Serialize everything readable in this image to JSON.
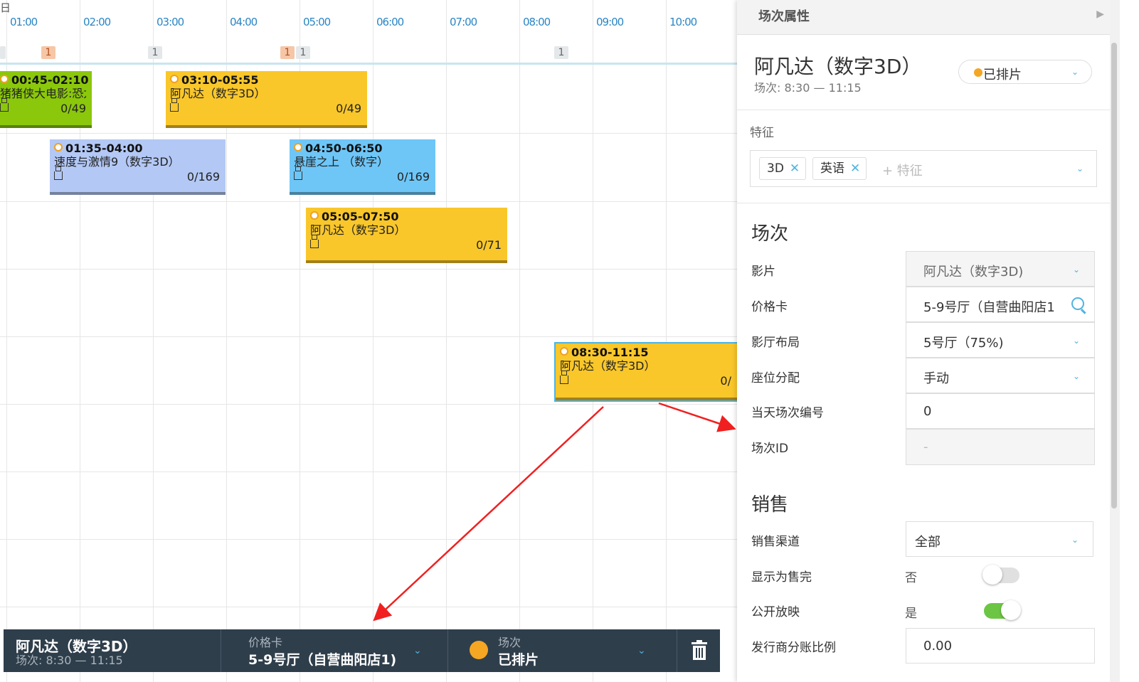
{
  "timeline": {
    "day_label": "日",
    "hours": [
      "01:00",
      "02:00",
      "03:00",
      "04:00",
      "05:00",
      "06:00",
      "07:00",
      "08:00",
      "09:00",
      "10:00"
    ],
    "counts": [
      {
        "value": "1",
        "style": "orange"
      },
      {
        "value": "1",
        "style": "grey"
      },
      {
        "value": "1",
        "style": "orange"
      },
      {
        "value": "1",
        "style": "grey"
      },
      {
        "value": "1",
        "style": "grey"
      }
    ],
    "sessions": [
      {
        "time": "00:45-02:10",
        "title": "猪猪侠大电影:恐龙",
        "occupancy": "0/49",
        "color": "green"
      },
      {
        "time": "03:10-05:55",
        "title": "阿凡达（数字3D）",
        "occupancy": "0/49",
        "color": "yellow"
      },
      {
        "time": "01:35-04:00",
        "title": "速度与激情9（数字3D）",
        "occupancy": "0/169",
        "color": "lightblue"
      },
      {
        "time": "04:50-06:50",
        "title": "悬崖之上 （数字）",
        "occupancy": "0/169",
        "color": "skyblue"
      },
      {
        "time": "05:05-07:50",
        "title": "阿凡达（数字3D）",
        "occupancy": "0/71",
        "color": "yellow"
      },
      {
        "time": "08:30-11:15",
        "title": "阿凡达（数字3D）",
        "occupancy": "0/",
        "color": "yellow"
      }
    ]
  },
  "bottom_bar": {
    "movie_title": "阿凡达（数字3D）",
    "movie_time": "场次: 8:30 — 11:15",
    "price_card_label": "价格卡",
    "price_card_value": "5-9号厅（自营曲阳店1)",
    "session_label": "场次",
    "session_value": "已排片",
    "status_color": "#f5a623"
  },
  "panel": {
    "title": "场次属性",
    "movie_title": "阿凡达（数字3D）",
    "movie_time": "场次: 8:30 — 11:15",
    "status": "已排片",
    "features_label": "特征",
    "tags": [
      "3D",
      "英语"
    ],
    "feature_placeholder": "+ 特征",
    "section_session": "场次",
    "fields": {
      "film": {
        "label": "影片",
        "value": "阿凡达（数字3D)"
      },
      "price_card": {
        "label": "价格卡",
        "value": "5-9号厅（自营曲阳店1"
      },
      "hall_layout": {
        "label": "影厅布局",
        "value": "5号厅（75%)"
      },
      "seat_allocation": {
        "label": "座位分配",
        "value": "手动"
      },
      "daily_number": {
        "label": "当天场次编号",
        "value": "0"
      },
      "session_id": {
        "label": "场次ID",
        "value": "-"
      }
    },
    "section_sales": "销售",
    "sales": {
      "channel": {
        "label": "销售渠道",
        "value": "全部"
      },
      "sold_out": {
        "label": "显示为售完",
        "state_text": "否",
        "on": false
      },
      "public": {
        "label": "公开放映",
        "state_text": "是",
        "on": true
      },
      "distributor_share": {
        "label": "发行商分账比例",
        "value": "0.00"
      }
    }
  },
  "colors": {
    "accent": "#4fb3df",
    "status_orange": "#f5a623",
    "toggle_on": "#6cc644",
    "bar_bg": "#2f3e4b"
  }
}
